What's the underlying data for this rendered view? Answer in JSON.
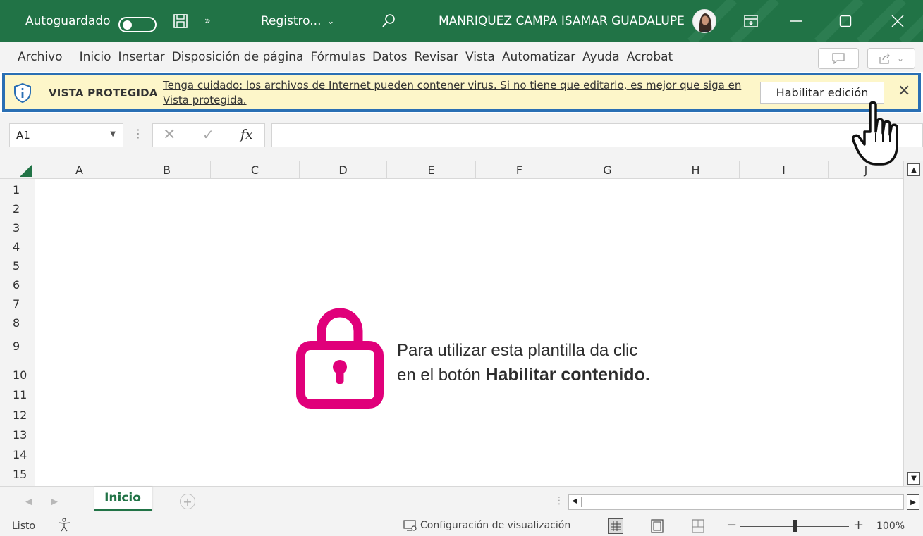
{
  "titlebar": {
    "autosave_label": "Autoguardado",
    "autosave_state": "off",
    "doc_name": "Registro...",
    "user_name": "MANRIQUEZ CAMPA ISAMAR GUADALUPE",
    "bg_color": "#217346"
  },
  "menu": {
    "tabs": [
      {
        "label": "Archivo"
      },
      {
        "label": "Inicio"
      },
      {
        "label": "Insertar"
      },
      {
        "label": "Disposición de página"
      },
      {
        "label": "Fórmulas"
      },
      {
        "label": "Datos"
      },
      {
        "label": "Revisar"
      },
      {
        "label": "Vista"
      },
      {
        "label": "Automatizar"
      },
      {
        "label": "Ayuda"
      },
      {
        "label": "Acrobat"
      }
    ]
  },
  "protected_view": {
    "title": "VISTA PROTEGIDA",
    "message": "Tenga cuidado: los archivos de Internet pueden contener virus. Si no tiene que editarlo, es mejor que siga en Vista protegida.",
    "enable_button": "Habilitar edición",
    "highlight_color": "#2a6fb4",
    "bg_color": "#fdf6c9"
  },
  "formula_bar": {
    "name_box": "A1",
    "fx_label": "fx",
    "value": ""
  },
  "grid": {
    "columns": [
      "A",
      "B",
      "C",
      "D",
      "E",
      "F",
      "G",
      "H",
      "I",
      "J"
    ],
    "rows": [
      "1",
      "2",
      "3",
      "4",
      "5",
      "6",
      "7",
      "8",
      "9",
      "10",
      "11",
      "12",
      "13",
      "14",
      "15"
    ]
  },
  "content": {
    "line1": "Para utilizar esta plantilla da clic",
    "line2_prefix": "en el botón ",
    "line2_bold": "Habilitar contenido.",
    "lock_color": "#e0007a"
  },
  "sheets": {
    "tabs": [
      {
        "label": "Inicio",
        "active": true
      }
    ]
  },
  "status": {
    "ready": "Listo",
    "display_settings": "Configuración de visualización",
    "zoom": "100%",
    "zoom_fraction": 0.5
  }
}
